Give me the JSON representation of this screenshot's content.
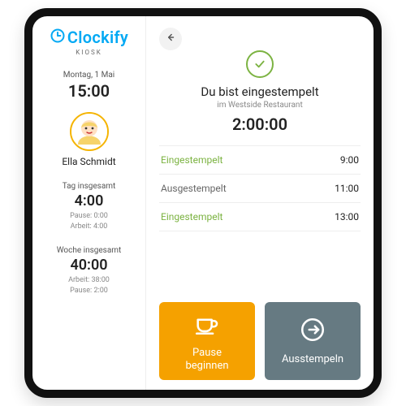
{
  "brand": {
    "name": "Clockify",
    "sub": "KIOSK"
  },
  "sidebar": {
    "date": "Montag, 1 Mai",
    "time": "15:00",
    "user_name": "Ella Schmidt",
    "day": {
      "label": "Tag insgesamt",
      "value": "4:00",
      "pause_label": "Pause:",
      "pause_value": "0:00",
      "work_label": "Arbeit:",
      "work_value": "4:00"
    },
    "week": {
      "label": "Woche insgesamt",
      "value": "40:00",
      "work_label": "Arbeit:",
      "work_value": "38:00",
      "pause_label": "Pause:",
      "pause_value": "2:00"
    }
  },
  "status": {
    "title": "Du bist eingestempelt",
    "location_prefix": "im",
    "location": "Westside Restaurant",
    "elapsed": "2:00:00"
  },
  "log": [
    {
      "label": "Eingestempelt",
      "time": "9:00",
      "kind": "in"
    },
    {
      "label": "Ausgestempelt",
      "time": "11:00",
      "kind": "out"
    },
    {
      "label": "Eingestempelt",
      "time": "13:00",
      "kind": "in"
    }
  ],
  "actions": {
    "pause_label": "Pause\nbeginnen",
    "clockout_label": "Ausstempeln"
  },
  "colors": {
    "brand": "#03A9F4",
    "accent_green": "#7cb342",
    "btn_pause": "#f5a100",
    "btn_out": "#667a82"
  }
}
